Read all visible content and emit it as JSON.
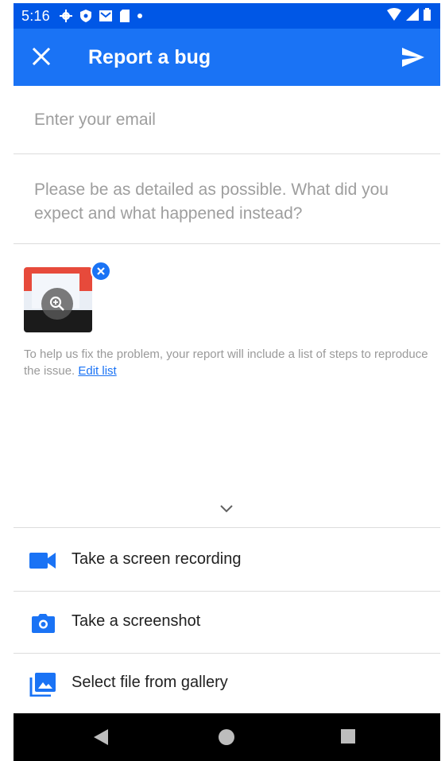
{
  "status_bar": {
    "time": "5:16",
    "icons": [
      "settings-icon",
      "shield-icon",
      "mail-icon",
      "sd-card-icon",
      "dot-icon"
    ],
    "right_icons": [
      "wifi-icon",
      "signal-icon",
      "battery-icon"
    ]
  },
  "app_bar": {
    "title": "Report a bug",
    "close_icon": "close-icon",
    "send_icon": "send-icon",
    "color": "#1a73f5"
  },
  "form": {
    "email_placeholder": "Enter your email",
    "description_placeholder": "Please be as detailed as possible. What did you expect and what happened instead?"
  },
  "attachment": {
    "zoom_icon": "zoom-in-icon",
    "remove_icon": "close-circle-icon"
  },
  "note": {
    "text": "To help us fix the problem, your report will include a list of steps to reproduce the issue. ",
    "link": "Edit list"
  },
  "actions": [
    {
      "label": "Take a screen recording",
      "icon": "videocam-icon"
    },
    {
      "label": "Take a screenshot",
      "icon": "camera-icon"
    },
    {
      "label": "Select file from gallery",
      "icon": "gallery-icon"
    }
  ],
  "nav_bar": {
    "icons": [
      "back-icon",
      "home-icon",
      "recents-icon"
    ]
  }
}
